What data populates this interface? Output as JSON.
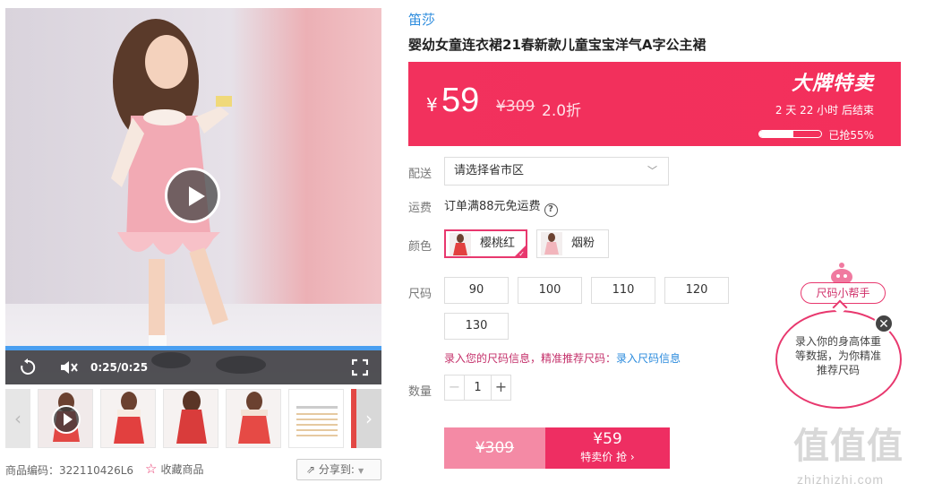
{
  "video": {
    "time": "0:25/0:25"
  },
  "meta": {
    "sku_code": "商品编码：322110426L6",
    "favorite_label": "收藏商品",
    "share_label": "分享到:"
  },
  "product": {
    "brand": "笛莎",
    "title": "婴幼女童连衣裙21春新款儿童宝宝洋气A字公主裙"
  },
  "price_band": {
    "currency": "¥",
    "price": "59",
    "original_price": "¥309",
    "discount": "2.0折",
    "tag": "大牌特卖",
    "countdown": "2 天 22 小时 后结束",
    "sold_ratio": 0.55,
    "sold_text": "已抢55%"
  },
  "delivery": {
    "label": "配送",
    "placeholder": "请选择省市区"
  },
  "shipping": {
    "label": "运费",
    "text": "订单满88元免运费"
  },
  "colors": {
    "label": "颜色",
    "options": [
      {
        "name": "樱桃红",
        "selected": true
      },
      {
        "name": "烟粉",
        "selected": false
      }
    ]
  },
  "sizes": {
    "label": "尺码",
    "options": [
      "90",
      "100",
      "110",
      "120",
      "130"
    ],
    "hint": "录入您的尺码信息，精准推荐尺码：",
    "hint_link": "录入尺码信息"
  },
  "quantity": {
    "label": "数量",
    "value": "1"
  },
  "buy": {
    "original": "¥309",
    "price": "¥59",
    "action": "特卖价 抢 ›"
  },
  "size_helper": {
    "title": "尺码小帮手",
    "text": "录入你的身高体重等数据，为你精准推荐尺码"
  },
  "watermark": {
    "logo": "值值值",
    "text": "zhizhizhi.com"
  },
  "colors_theme": {
    "accent": "#f2315d",
    "link": "#2b8bdd",
    "pink_light": "#f48aa5"
  }
}
